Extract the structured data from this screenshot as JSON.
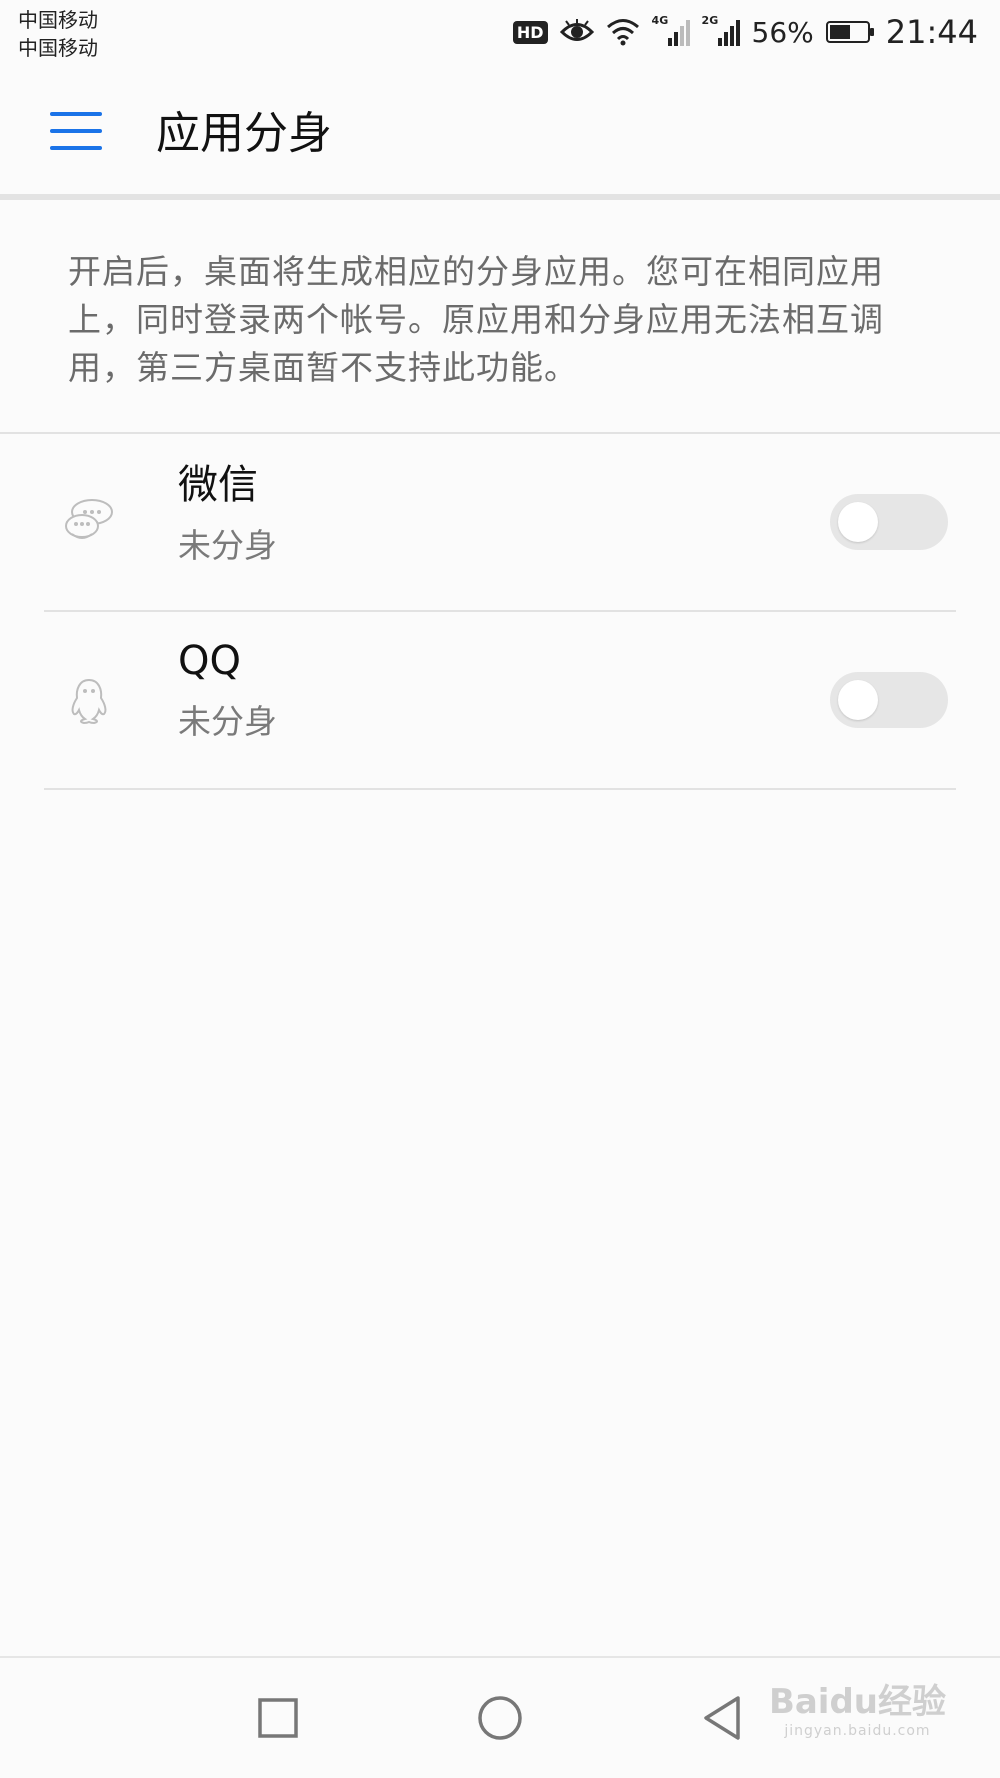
{
  "status_bar": {
    "carrier_1": "中国移动",
    "carrier_2": "中国移动",
    "hd_badge": "HD",
    "sim1_network": "4G",
    "sim2_network": "2G",
    "battery_percent": "56%",
    "battery_level": 0.56,
    "time": "21:44",
    "icons": [
      "hd-icon",
      "eye-comfort-icon",
      "wifi-icon",
      "signal-icon",
      "signal-icon",
      "battery-icon"
    ]
  },
  "header": {
    "title": "应用分身",
    "menu_icon": "menu-icon",
    "accent_color": "#1a73e8"
  },
  "description": "开启后，桌面将生成相应的分身应用。您可在相同应用上，同时登录两个帐号。原应用和分身应用无法相互调用，第三方桌面暂不支持此功能。",
  "apps": [
    {
      "name": "微信",
      "status": "未分身",
      "icon": "wechat-icon",
      "enabled": false
    },
    {
      "name": "QQ",
      "status": "未分身",
      "icon": "qq-icon",
      "enabled": false
    }
  ],
  "nav_bar": {
    "icons": [
      "recent-apps-icon",
      "home-icon",
      "back-icon"
    ]
  },
  "watermark": {
    "main": "Baidu经验",
    "sub": "jingyan.baidu.com"
  }
}
